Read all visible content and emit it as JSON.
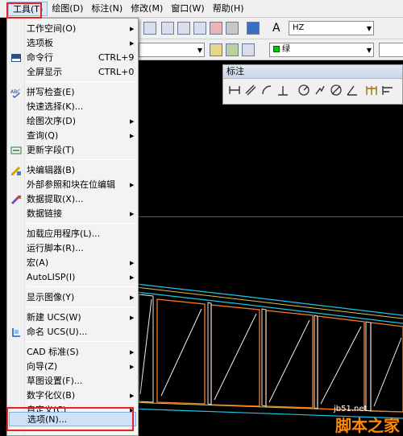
{
  "menubar": {
    "items": [
      {
        "label": "工具(T)",
        "active": true
      },
      {
        "label": "绘图(D)"
      },
      {
        "label": "标注(N)"
      },
      {
        "label": "修改(M)"
      },
      {
        "label": "窗口(W)"
      },
      {
        "label": "帮助(H)"
      }
    ]
  },
  "toolbar": {
    "text_style": "HZ",
    "color": "绿",
    "color_hex": "#00c800"
  },
  "dim_toolbar": {
    "title": "标注"
  },
  "tools_menu": {
    "items": [
      {
        "label": "工作空间(O)",
        "submenu": true
      },
      {
        "label": "选项板",
        "submenu": true
      },
      {
        "label": "命令行",
        "shortcut": "CTRL+9",
        "icon": "command-line-icon"
      },
      {
        "label": "全屏显示",
        "shortcut": "CTRL+0"
      },
      {
        "label": "拼写检查(E)",
        "icon": "spell-check-icon"
      },
      {
        "label": "快速选择(K)..."
      },
      {
        "label": "绘图次序(D)",
        "submenu": true
      },
      {
        "label": "查询(Q)",
        "submenu": true
      },
      {
        "label": "更新字段(T)",
        "icon": "update-field-icon"
      },
      {
        "label": "块编辑器(B)",
        "icon": "block-editor-icon"
      },
      {
        "label": "外部参照和块在位编辑",
        "submenu": true
      },
      {
        "label": "数据提取(X)...",
        "icon": "data-extraction-icon"
      },
      {
        "label": "数据链接",
        "submenu": true
      },
      {
        "label": "加载应用程序(L)..."
      },
      {
        "label": "运行脚本(R)..."
      },
      {
        "label": "宏(A)",
        "submenu": true
      },
      {
        "label": "AutoLISP(I)",
        "submenu": true
      },
      {
        "label": "显示图像(Y)",
        "submenu": true
      },
      {
        "label": "新建 UCS(W)",
        "submenu": true
      },
      {
        "label": "命名 UCS(U)...",
        "icon": "named-ucs-icon"
      },
      {
        "label": "CAD 标准(S)",
        "submenu": true
      },
      {
        "label": "向导(Z)",
        "submenu": true
      },
      {
        "label": "草图设置(F)..."
      },
      {
        "label": "数字化仪(B)",
        "submenu": true
      },
      {
        "label": "自定义(C)",
        "submenu": true
      },
      {
        "label": "选项(N)...",
        "highlighted": true
      }
    ]
  },
  "watermark": {
    "site": "jb51.net",
    "brand": "脚本之家"
  },
  "colors": {
    "annotation_red": "#e8202a",
    "drawing_bg": "#000000"
  }
}
